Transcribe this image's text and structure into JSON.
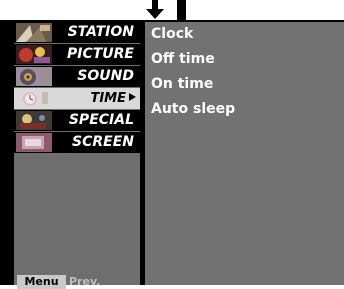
{
  "sidebar": {
    "items": [
      {
        "label": "STATION"
      },
      {
        "label": "PICTURE"
      },
      {
        "label": "SOUND"
      },
      {
        "label": "TIME"
      },
      {
        "label": "SPECIAL"
      },
      {
        "label": "SCREEN"
      }
    ],
    "selected": "TIME"
  },
  "submenu": {
    "items": [
      {
        "label": "Clock"
      },
      {
        "label": "Off time"
      },
      {
        "label": "On time"
      },
      {
        "label": "Auto sleep"
      }
    ]
  },
  "footer": {
    "menu_key": "Menu",
    "prev_label": "Prev."
  },
  "colors": {
    "panel_background": "#000000",
    "sidebar_background": "#6e6e6e",
    "submenu_background": "#727272",
    "selected_item": "#d9d9d9",
    "text": "#ffffff"
  },
  "icons": [
    "down-arrow-icon",
    "up-arrow-icon",
    "station-icon",
    "picture-icon",
    "sound-icon",
    "time-icon",
    "special-icon",
    "screen-icon",
    "right-arrow-icon"
  ]
}
